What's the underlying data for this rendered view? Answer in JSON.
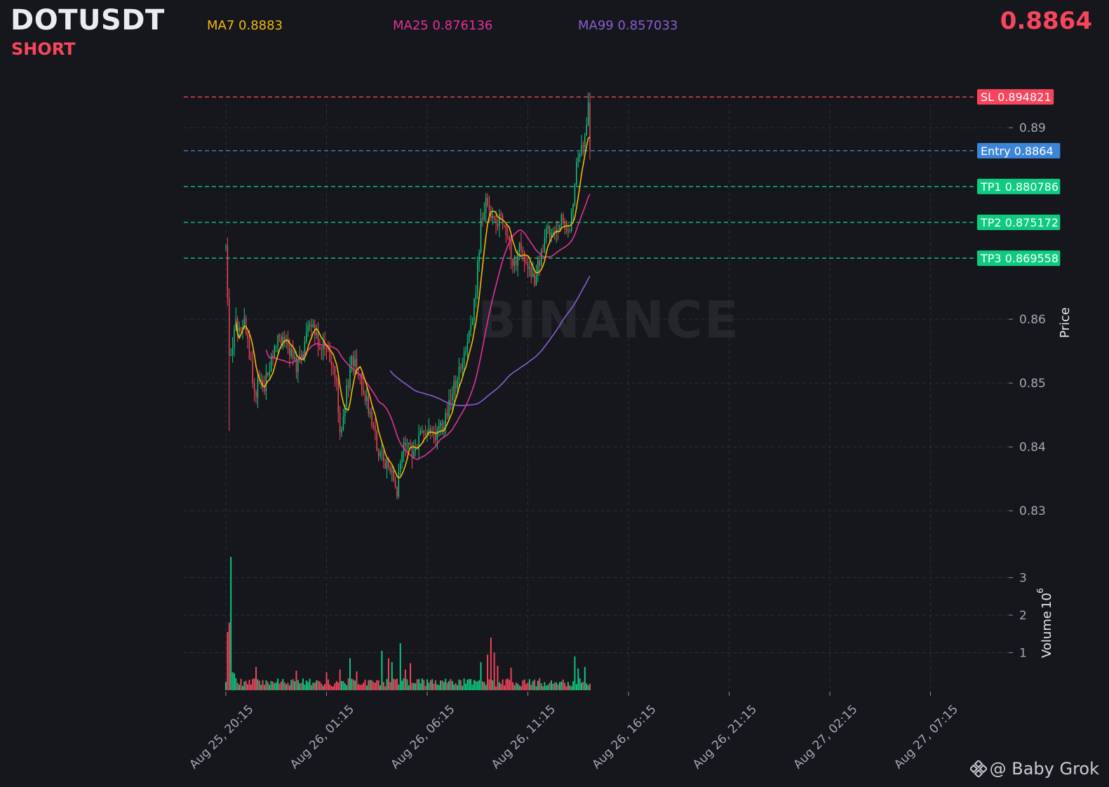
{
  "header": {
    "symbol": "DOTUSDT",
    "side": "SHORT",
    "ma7_label": "MA7 0.8883",
    "ma25_label": "MA25 0.876136",
    "ma99_label": "MA99 0.857033",
    "last_price": "0.8864"
  },
  "watermark": "BINANCE",
  "brand": {
    "text": "@ Baby Grok",
    "icon": "binance-logo-icon"
  },
  "colors": {
    "background": "#16171c",
    "up": "#0ecb81",
    "down": "#f6465d",
    "ma7": "#f0b90b",
    "ma25": "#e0319b",
    "ma99": "#8a5cd6",
    "entry": "#3d85d8",
    "tp": "#0ecb81",
    "sl": "#f6465d"
  },
  "chart_data": {
    "type": "candlestick",
    "xlabel": "",
    "ylabel": "Price",
    "ylim": [
      0.8265,
      0.8955
    ],
    "yticks": [
      0.83,
      0.84,
      0.85,
      0.86,
      0.89
    ],
    "xticks": [
      "Aug 25, 20:15",
      "Aug 26, 01:15",
      "Aug 26, 06:15",
      "Aug 26, 11:15",
      "Aug 26, 16:15",
      "Aug 26, 21:15",
      "Aug 27, 02:15",
      "Aug 27, 07:15"
    ],
    "interval_minutes": 5,
    "grid": true,
    "levels": [
      {
        "name": "SL",
        "label": "SL 0.894821",
        "value": 0.894821,
        "color": "#f6465d"
      },
      {
        "name": "Entry",
        "label": "Entry 0.8864",
        "value": 0.8864,
        "color": "#3d85d8"
      },
      {
        "name": "TP1",
        "label": "TP1 0.880786",
        "value": 0.880786,
        "color": "#0ecb81"
      },
      {
        "name": "TP2",
        "label": "TP2 0.875172",
        "value": 0.875172,
        "color": "#0ecb81"
      },
      {
        "name": "TP3",
        "label": "TP3 0.869558",
        "value": 0.869558,
        "color": "#0ecb81"
      }
    ],
    "price_keypoints": [
      [
        0,
        0.8715
      ],
      [
        1,
        0.862
      ],
      [
        2,
        0.855
      ],
      [
        4,
        0.856
      ],
      [
        6,
        0.86
      ],
      [
        8,
        0.8585
      ],
      [
        10,
        0.86
      ],
      [
        12,
        0.858
      ],
      [
        16,
        0.8505
      ],
      [
        18,
        0.849
      ],
      [
        20,
        0.8505
      ],
      [
        23,
        0.8495
      ],
      [
        26,
        0.8525
      ],
      [
        30,
        0.857
      ],
      [
        34,
        0.8565
      ],
      [
        38,
        0.855
      ],
      [
        42,
        0.8525
      ],
      [
        46,
        0.8555
      ],
      [
        50,
        0.859
      ],
      [
        55,
        0.8565
      ],
      [
        59,
        0.855
      ],
      [
        62,
        0.8535
      ],
      [
        66,
        0.8495
      ],
      [
        68,
        0.8415
      ],
      [
        70,
        0.8445
      ],
      [
        72,
        0.8485
      ],
      [
        74,
        0.8525
      ],
      [
        76,
        0.8535
      ],
      [
        80,
        0.8505
      ],
      [
        84,
        0.8475
      ],
      [
        88,
        0.8425
      ],
      [
        92,
        0.8385
      ],
      [
        96,
        0.837
      ],
      [
        100,
        0.8345
      ],
      [
        102,
        0.8335
      ],
      [
        104,
        0.8375
      ],
      [
        108,
        0.8415
      ],
      [
        112,
        0.839
      ],
      [
        116,
        0.8415
      ],
      [
        120,
        0.8425
      ],
      [
        124,
        0.8415
      ],
      [
        128,
        0.8425
      ],
      [
        132,
        0.8455
      ],
      [
        136,
        0.8495
      ],
      [
        140,
        0.8525
      ],
      [
        144,
        0.8555
      ],
      [
        148,
        0.8625
      ],
      [
        150,
        0.868
      ],
      [
        152,
        0.875
      ],
      [
        156,
        0.879
      ],
      [
        160,
        0.875
      ],
      [
        164,
        0.876
      ],
      [
        168,
        0.872
      ],
      [
        172,
        0.8685
      ],
      [
        176,
        0.8715
      ],
      [
        180,
        0.8685
      ],
      [
        184,
        0.8655
      ],
      [
        188,
        0.8705
      ],
      [
        192,
        0.8745
      ],
      [
        196,
        0.8725
      ],
      [
        200,
        0.8755
      ],
      [
        204,
        0.8735
      ],
      [
        206,
        0.8765
      ],
      [
        208,
        0.8815
      ],
      [
        210,
        0.8855
      ],
      [
        212,
        0.8885
      ],
      [
        214,
        0.8875
      ],
      [
        216,
        0.8935
      ],
      [
        217,
        0.8865
      ]
    ],
    "volume": {
      "ylabel": "Volume",
      "unit_exponent": 6,
      "yticks": [
        1,
        2,
        3
      ],
      "ylim": [
        0,
        3.55
      ],
      "spikes": [
        [
          0,
          0.22
        ],
        [
          1,
          1.55
        ],
        [
          2,
          1.8
        ],
        [
          3,
          3.55
        ],
        [
          4,
          0.48
        ],
        [
          5,
          0.45
        ],
        [
          6,
          0.32
        ],
        [
          18,
          0.62
        ],
        [
          42,
          0.52
        ],
        [
          60,
          0.48
        ],
        [
          68,
          0.55
        ],
        [
          74,
          0.85
        ],
        [
          78,
          0.5
        ],
        [
          93,
          1.05
        ],
        [
          97,
          0.85
        ],
        [
          99,
          0.75
        ],
        [
          104,
          1.25
        ],
        [
          107,
          0.55
        ],
        [
          110,
          0.72
        ],
        [
          152,
          0.75
        ],
        [
          156,
          0.95
        ],
        [
          158,
          1.4
        ],
        [
          160,
          1.0
        ],
        [
          162,
          0.65
        ],
        [
          170,
          0.6
        ],
        [
          208,
          0.9
        ],
        [
          210,
          0.58
        ],
        [
          214,
          0.62
        ]
      ]
    }
  }
}
